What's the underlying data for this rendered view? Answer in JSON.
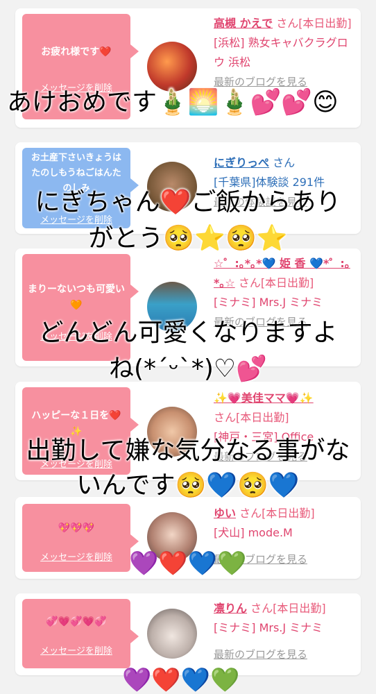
{
  "cards": [
    {
      "bubble_text": "お疲れ様です❤️",
      "delete_label": "メッセージを削除",
      "name": "高槻 かえで",
      "san": "さん[本日出勤]",
      "shop": "[浜松] 熟女キャバクラグロウ 浜松",
      "blog": "最新のブログを見る"
    },
    {
      "bubble_text": "お土産下さいきょうはたのしもうねごはんたのしみ",
      "delete_label": "メッセージを削除",
      "name": "にぎりっぺ",
      "san": "さん",
      "shop": "[千葉県]体験談 291件",
      "blog": "最新の体験談を見る"
    },
    {
      "bubble_text": "まりーないつも可愛い🧡",
      "delete_label": "メッセージを削除",
      "name": "☆゜:｡*｡*💙 姫 香 💙*゜:｡*｡☆",
      "san": "さん[本日出勤]",
      "shop": "[ミナミ] Mrs.J ミナミ",
      "blog": "最新のブログを見る"
    },
    {
      "bubble_text": "ハッピーな１日を❤️✨",
      "delete_label": "メッセージを削除",
      "name": "✨💗美佳ママ💗✨",
      "san": "さん[本日出勤]",
      "shop": "[神戸・三宮] Office",
      "blog": "最新のブログを見る"
    },
    {
      "bubble_text": "💖💖💖",
      "delete_label": "メッセージを削除",
      "name": "ゆい",
      "san": "さん[本日出勤]",
      "shop": "[犬山] mode.M",
      "blog": "最新のブログを見る"
    },
    {
      "bubble_text": "💞💗💞💗💞",
      "delete_label": "メッセージを削除",
      "name": "凛りん",
      "san": "さん[本日出勤]",
      "shop": "[ミナミ] Mrs.J ミナミ",
      "blog": "最新のブログを見る"
    }
  ],
  "overlays": {
    "o1": "あけおめです🎍🌅🎍💕💕😊",
    "o2a": "にぎちゃん❤️ご飯からあり",
    "o2b": "がとう🥺⭐️🥺⭐️",
    "o3a": "どんどん可愛くなりますよ",
    "o3b": "ね(*ˊᵕˋ*)♡💕",
    "o4a": "出勤して嫌な気分なる事がな",
    "o4b": "いんです🥺💙🥺💙",
    "o5": "💜❤️💙💚",
    "o6": "💜❤️💙💚"
  }
}
